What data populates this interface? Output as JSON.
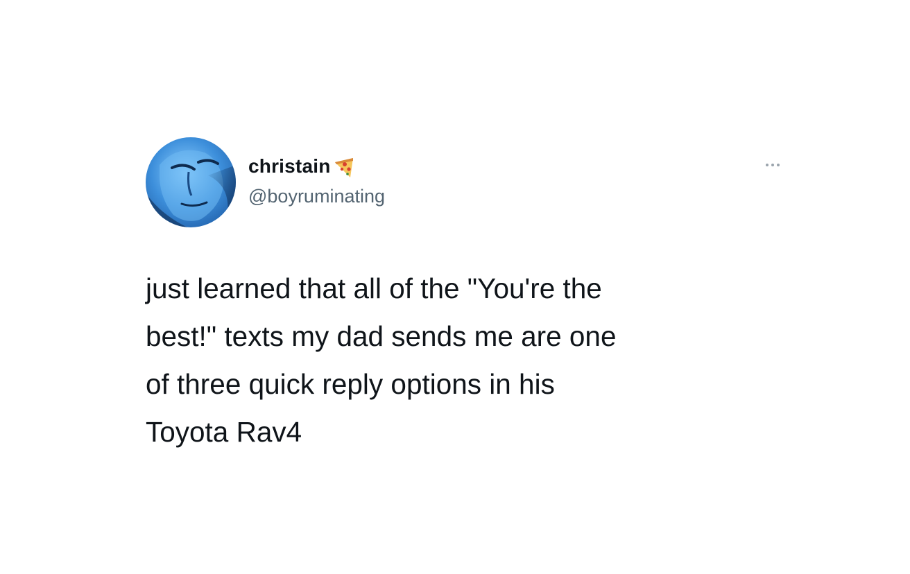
{
  "tweet": {
    "author": {
      "display_name": "christain",
      "name_emoji_icon": "pizza-icon",
      "handle": "@boyruminating",
      "avatar_icon": "blue-face-avatar"
    },
    "more_icon": "more-options-icon",
    "text_lines": [
      "just learned that all of the \"You're the",
      "best!\" texts my dad sends me are one",
      "of three quick reply options in his",
      "Toyota Rav4"
    ]
  },
  "colors": {
    "background": "#ffffff",
    "text_primary": "#0f1419",
    "text_secondary": "#536471",
    "avatar_blue": "#3f8fd6"
  }
}
